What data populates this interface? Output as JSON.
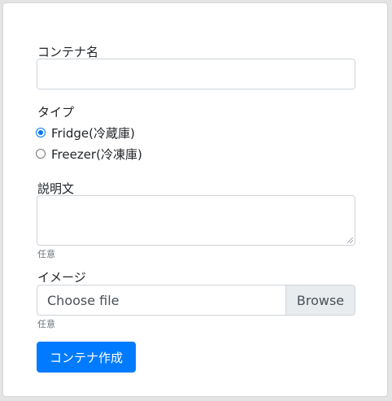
{
  "form": {
    "container_name": {
      "label": "コンテナ名",
      "value": ""
    },
    "type": {
      "label": "タイプ",
      "options": [
        {
          "label": "Fridge(冷蔵庫)",
          "checked": true
        },
        {
          "label": "Freezer(冷凍庫)",
          "checked": false
        }
      ]
    },
    "description": {
      "label": "説明文",
      "value": "",
      "help": "任意"
    },
    "image": {
      "label": "イメージ",
      "placeholder": "Choose file",
      "browse_label": "Browse",
      "help": "任意"
    },
    "submit_label": "コンテナ作成"
  },
  "colors": {
    "primary": "#007bff",
    "radio_checked": "#0075ff",
    "border": "#ced4da",
    "muted": "#6c757d",
    "browse_bg": "#e9ecef"
  }
}
